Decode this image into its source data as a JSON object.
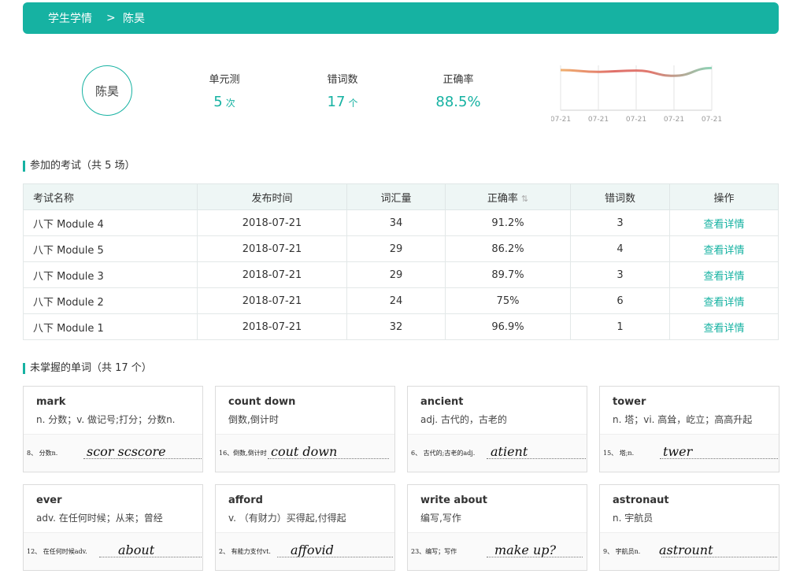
{
  "breadcrumb": {
    "root": "学生学情",
    "separator": ">",
    "current": "陈昊"
  },
  "student": {
    "name": "陈昊"
  },
  "stats": [
    {
      "label": "单元测",
      "value": "5",
      "unit": "次"
    },
    {
      "label": "错词数",
      "value": "17",
      "unit": "个"
    },
    {
      "label": "正确率",
      "value": "88.5%",
      "unit": ""
    }
  ],
  "trend": {
    "dates": [
      "07-21",
      "07-21",
      "07-21",
      "07-21",
      "07-21"
    ],
    "accuracy": [
      91.2,
      86.2,
      89.7,
      75,
      96.9
    ]
  },
  "exams_section": {
    "title": "参加的考试（共 5 场）"
  },
  "exams_table": {
    "headers": [
      "考试名称",
      "发布时间",
      "词汇量",
      "正确率",
      "错词数",
      "操作"
    ],
    "rows": [
      {
        "name": "八下 Module 4",
        "date": "2018-07-21",
        "vocab": "34",
        "accuracy": "91.2%",
        "errors": "3",
        "action": "查看详情"
      },
      {
        "name": "八下 Module 5",
        "date": "2018-07-21",
        "vocab": "29",
        "accuracy": "86.2%",
        "errors": "4",
        "action": "查看详情"
      },
      {
        "name": "八下 Module 3",
        "date": "2018-07-21",
        "vocab": "29",
        "accuracy": "89.7%",
        "errors": "3",
        "action": "查看详情"
      },
      {
        "name": "八下 Module 2",
        "date": "2018-07-21",
        "vocab": "24",
        "accuracy": "75%",
        "errors": "6",
        "action": "查看详情"
      },
      {
        "name": "八下 Module 1",
        "date": "2018-07-21",
        "vocab": "32",
        "accuracy": "96.9%",
        "errors": "1",
        "action": "查看详情"
      }
    ]
  },
  "words_section": {
    "title": "未掌握的单词（共 17 个）"
  },
  "words": [
    {
      "word": "mark",
      "meaning": "n. 分数；v. 做记号;打分；分数n.",
      "prompt": "8、 分数n.",
      "answer": "scor scscore"
    },
    {
      "word": "count down",
      "meaning": "倒数,倒计时",
      "prompt": "16、倒数,倒计时",
      "answer": "cout down"
    },
    {
      "word": "ancient",
      "meaning": "adj. 古代的，古老的",
      "prompt": "6、 古代的;古老的adj.",
      "answer": "atient"
    },
    {
      "word": "tower",
      "meaning": "n. 塔；vi. 高耸，屹立；高高升起",
      "prompt": "15、 塔;n.",
      "answer": "twer"
    },
    {
      "word": "ever",
      "meaning": "adv. 在任何时候；从来；曾经",
      "prompt": "12、 在任何时候adv.",
      "answer": "about"
    },
    {
      "word": "afford",
      "meaning": "v. （有财力）买得起,付得起",
      "prompt": "2、 有能力支付vt.",
      "answer": "affovid"
    },
    {
      "word": "write about",
      "meaning": "编写,写作",
      "prompt": "23、编写；写作",
      "answer": "make up?"
    },
    {
      "word": "astronaut",
      "meaning": "n. 宇航员",
      "prompt": "9、 宇航员n.",
      "answer": "astrount"
    }
  ]
}
